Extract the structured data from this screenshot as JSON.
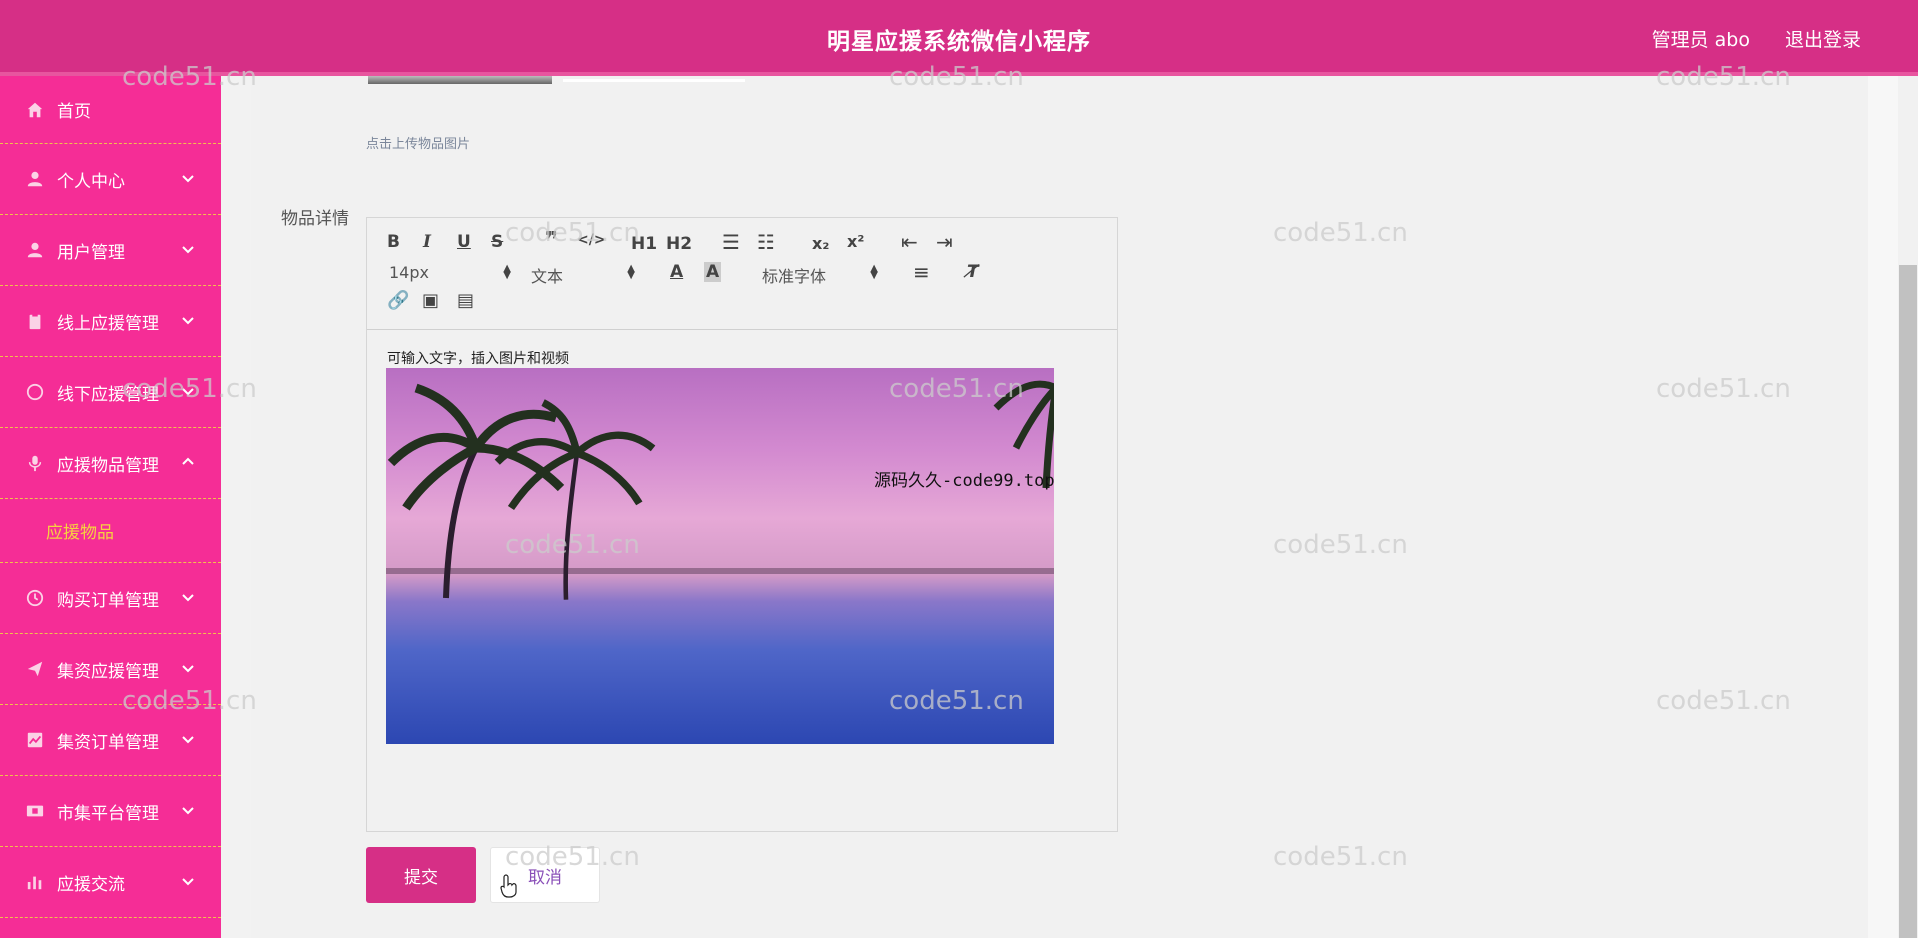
{
  "header": {
    "title": "明星应援系统微信小程序",
    "user": "管理员 abo",
    "logout": "退出登录"
  },
  "sidebar": {
    "items": [
      {
        "label": "首页",
        "icon": "home-icon"
      },
      {
        "label": "个人中心",
        "icon": "user-icon"
      },
      {
        "label": "用户管理",
        "icon": "user-icon"
      },
      {
        "label": "线上应援管理",
        "icon": "clipboard-icon"
      },
      {
        "label": "线下应援管理",
        "icon": "compass-icon"
      },
      {
        "label": "应援物品管理",
        "icon": "microphone-icon"
      },
      {
        "label": "购买订单管理",
        "icon": "clock-icon"
      },
      {
        "label": "集资应援管理",
        "icon": "send-icon"
      },
      {
        "label": "集资订单管理",
        "icon": "chart-icon"
      },
      {
        "label": "市集平台管理",
        "icon": "film-icon"
      },
      {
        "label": "应援交流",
        "icon": "bar-chart-icon"
      }
    ],
    "sub_item": "应援物品"
  },
  "form": {
    "upload_hint": "点击上传物品图片",
    "detail_label": "物品详情",
    "editor_placeholder": "可输入文字，插入图片和视频",
    "submit": "提交",
    "cancel": "取消"
  },
  "toolbar": {
    "font_size": "14px",
    "block_type": "文本",
    "font_family": "标准字体",
    "h1": "H1",
    "h2": "H2"
  },
  "watermark": "code51.cn",
  "overlay_text": "源码久久-code99.top"
}
